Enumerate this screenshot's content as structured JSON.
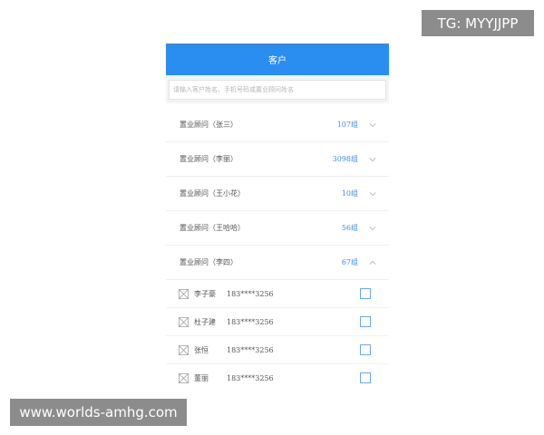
{
  "watermarks": {
    "top": "TG: MYYJJPP",
    "bottom": "www.worlds-amhg.com"
  },
  "header": {
    "title": "客户"
  },
  "search": {
    "placeholder": "请输入客户姓名、手机号码或置业顾问姓名"
  },
  "groups": [
    {
      "label": "置业顾问（张三）",
      "count": "107组",
      "expanded": false
    },
    {
      "label": "置业顾问（李丽）",
      "count": "3098组",
      "expanded": false
    },
    {
      "label": "置业顾问（王小花）",
      "count": "10组",
      "expanded": false
    },
    {
      "label": "置业顾问（王哈哈）",
      "count": "56组",
      "expanded": false
    },
    {
      "label": "置业顾问（李四）",
      "count": "67组",
      "expanded": true
    }
  ],
  "members": [
    {
      "name": "李子豪",
      "phone": "183****3256",
      "checked": false
    },
    {
      "name": "杜子建",
      "phone": "183****3256",
      "checked": false
    },
    {
      "name": "张恒",
      "phone": "183****3256",
      "checked": false
    },
    {
      "name": "董丽",
      "phone": "183****3256",
      "checked": false
    }
  ],
  "colors": {
    "header": "#2a8ef0",
    "count": "#3a8be0",
    "checkbox_border": "#6aa8e6"
  },
  "icons": {
    "collapsed": "chevron-down-icon",
    "expanded": "chevron-up-icon",
    "avatar": "image-placeholder-icon"
  }
}
